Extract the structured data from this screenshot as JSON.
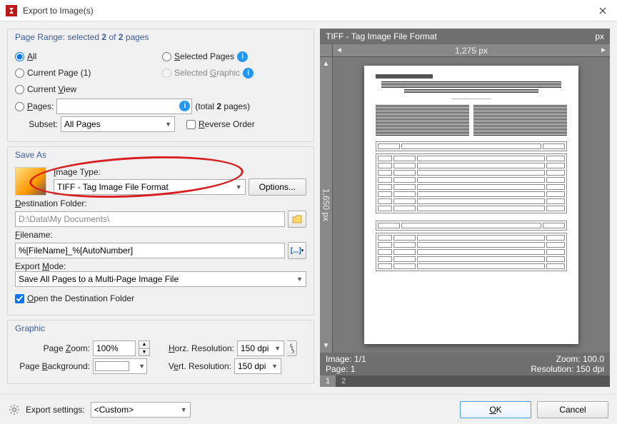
{
  "window": {
    "title": "Export to Image(s)"
  },
  "pageRange": {
    "title_html": "Page Range: selected <b>2</b> of <b>2</b> pages",
    "all": "All",
    "currentPage": "Current Page (1)",
    "currentView": "Current View",
    "pages": "Pages:",
    "selectedPages": "Selected Pages",
    "selectedGraphic": "Selected Graphic",
    "total_html": "(total <b>2</b> pages)",
    "subsetLabel": "Subset:",
    "subsetValue": "All Pages",
    "reverse": "Reverse Order"
  },
  "saveAs": {
    "title": "Save As",
    "imageTypeLabel": "Image Type:",
    "imageTypeValue": "TIFF - Tag Image File Format",
    "optionsBtn": "Options...",
    "destLabel": "Destination Folder:",
    "destValue": "D:\\Data\\My Documents\\",
    "filenameLabel": "Filename:",
    "filenameValue": "%[FileName]_%[AutoNumber]",
    "exportModeLabel": "Export Mode:",
    "exportModeValue": "Save All Pages to a Multi-Page Image File",
    "openDest": "Open the Destination Folder"
  },
  "graphic": {
    "title": "Graphic",
    "zoomLabel": "Page Zoom:",
    "zoomValue": "100%",
    "bgLabel": "Page Background:",
    "hresLabel": "Horz. Resolution:",
    "hresValue": "150 dpi",
    "vresLabel": "Vert. Resolution:",
    "vresValue": "150 dpi"
  },
  "preview": {
    "title": "TIFF - Tag Image File Format",
    "unit": "px",
    "widthLabel": "1,275 px",
    "heightLabel": "1,650 px",
    "statusImage": "Image: 1/1",
    "statusPage": "Page: 1",
    "statusZoom": "Zoom: 100.0",
    "statusRes": "Resolution: 150 dpi",
    "tabs": [
      "1",
      "2"
    ]
  },
  "bottom": {
    "settingsLabel": "Export settings:",
    "settingsValue": "<Custom>",
    "ok": "OK",
    "cancel": "Cancel"
  }
}
